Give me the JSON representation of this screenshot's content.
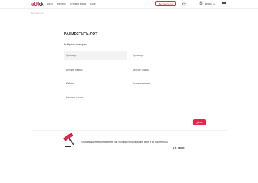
{
  "header": {
    "logo": {
      "part1": "e",
      "part2": "U",
      "part3": "kk"
    },
    "nav": [
      "Авто",
      "Мебель",
      "Готовые вещи",
      "Ещё"
    ],
    "sell_button": "Выставить лот",
    "username": "Игорь",
    "icons": [
      "messages-icon",
      "user-avatar",
      "chevron-down-icon",
      "menu-icon"
    ]
  },
  "breadcrumb": "Выставить лот",
  "main": {
    "title": "РАЗМЕСТИТЬ ЛОТ",
    "subtitle": "Выберите категорию",
    "left_categories": [
      "Транспорт",
      "Детские товары",
      "Мебель",
      "Бытовая техника"
    ],
    "right_categories": [
      "Транспорт",
      "Детские товары",
      "Бытовая техника"
    ],
    "selected": "Транспорт",
    "next_button": "Далее"
  },
  "footer": {
    "quote": "Проблема цитат в Интернете в том, что люди безоговорочно верят в их подлинность",
    "author": "В.И. ЛЕНИН",
    "accent_color": "#e4244a"
  }
}
